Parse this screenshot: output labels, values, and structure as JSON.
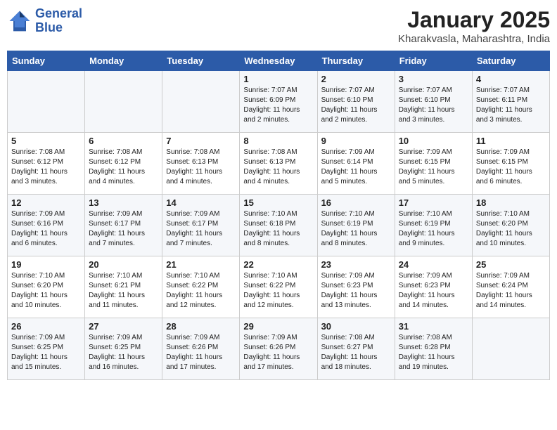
{
  "header": {
    "logo_line1": "General",
    "logo_line2": "Blue",
    "title": "January 2025",
    "subtitle": "Kharakvasla, Maharashtra, India"
  },
  "columns": [
    "Sunday",
    "Monday",
    "Tuesday",
    "Wednesday",
    "Thursday",
    "Friday",
    "Saturday"
  ],
  "weeks": [
    [
      {
        "day": "",
        "lines": []
      },
      {
        "day": "",
        "lines": []
      },
      {
        "day": "",
        "lines": []
      },
      {
        "day": "1",
        "lines": [
          "Sunrise: 7:07 AM",
          "Sunset: 6:09 PM",
          "Daylight: 11 hours",
          "and 2 minutes."
        ]
      },
      {
        "day": "2",
        "lines": [
          "Sunrise: 7:07 AM",
          "Sunset: 6:10 PM",
          "Daylight: 11 hours",
          "and 2 minutes."
        ]
      },
      {
        "day": "3",
        "lines": [
          "Sunrise: 7:07 AM",
          "Sunset: 6:10 PM",
          "Daylight: 11 hours",
          "and 3 minutes."
        ]
      },
      {
        "day": "4",
        "lines": [
          "Sunrise: 7:07 AM",
          "Sunset: 6:11 PM",
          "Daylight: 11 hours",
          "and 3 minutes."
        ]
      }
    ],
    [
      {
        "day": "5",
        "lines": [
          "Sunrise: 7:08 AM",
          "Sunset: 6:12 PM",
          "Daylight: 11 hours",
          "and 3 minutes."
        ]
      },
      {
        "day": "6",
        "lines": [
          "Sunrise: 7:08 AM",
          "Sunset: 6:12 PM",
          "Daylight: 11 hours",
          "and 4 minutes."
        ]
      },
      {
        "day": "7",
        "lines": [
          "Sunrise: 7:08 AM",
          "Sunset: 6:13 PM",
          "Daylight: 11 hours",
          "and 4 minutes."
        ]
      },
      {
        "day": "8",
        "lines": [
          "Sunrise: 7:08 AM",
          "Sunset: 6:13 PM",
          "Daylight: 11 hours",
          "and 4 minutes."
        ]
      },
      {
        "day": "9",
        "lines": [
          "Sunrise: 7:09 AM",
          "Sunset: 6:14 PM",
          "Daylight: 11 hours",
          "and 5 minutes."
        ]
      },
      {
        "day": "10",
        "lines": [
          "Sunrise: 7:09 AM",
          "Sunset: 6:15 PM",
          "Daylight: 11 hours",
          "and 5 minutes."
        ]
      },
      {
        "day": "11",
        "lines": [
          "Sunrise: 7:09 AM",
          "Sunset: 6:15 PM",
          "Daylight: 11 hours",
          "and 6 minutes."
        ]
      }
    ],
    [
      {
        "day": "12",
        "lines": [
          "Sunrise: 7:09 AM",
          "Sunset: 6:16 PM",
          "Daylight: 11 hours",
          "and 6 minutes."
        ]
      },
      {
        "day": "13",
        "lines": [
          "Sunrise: 7:09 AM",
          "Sunset: 6:17 PM",
          "Daylight: 11 hours",
          "and 7 minutes."
        ]
      },
      {
        "day": "14",
        "lines": [
          "Sunrise: 7:09 AM",
          "Sunset: 6:17 PM",
          "Daylight: 11 hours",
          "and 7 minutes."
        ]
      },
      {
        "day": "15",
        "lines": [
          "Sunrise: 7:10 AM",
          "Sunset: 6:18 PM",
          "Daylight: 11 hours",
          "and 8 minutes."
        ]
      },
      {
        "day": "16",
        "lines": [
          "Sunrise: 7:10 AM",
          "Sunset: 6:19 PM",
          "Daylight: 11 hours",
          "and 8 minutes."
        ]
      },
      {
        "day": "17",
        "lines": [
          "Sunrise: 7:10 AM",
          "Sunset: 6:19 PM",
          "Daylight: 11 hours",
          "and 9 minutes."
        ]
      },
      {
        "day": "18",
        "lines": [
          "Sunrise: 7:10 AM",
          "Sunset: 6:20 PM",
          "Daylight: 11 hours",
          "and 10 minutes."
        ]
      }
    ],
    [
      {
        "day": "19",
        "lines": [
          "Sunrise: 7:10 AM",
          "Sunset: 6:20 PM",
          "Daylight: 11 hours",
          "and 10 minutes."
        ]
      },
      {
        "day": "20",
        "lines": [
          "Sunrise: 7:10 AM",
          "Sunset: 6:21 PM",
          "Daylight: 11 hours",
          "and 11 minutes."
        ]
      },
      {
        "day": "21",
        "lines": [
          "Sunrise: 7:10 AM",
          "Sunset: 6:22 PM",
          "Daylight: 11 hours",
          "and 12 minutes."
        ]
      },
      {
        "day": "22",
        "lines": [
          "Sunrise: 7:10 AM",
          "Sunset: 6:22 PM",
          "Daylight: 11 hours",
          "and 12 minutes."
        ]
      },
      {
        "day": "23",
        "lines": [
          "Sunrise: 7:09 AM",
          "Sunset: 6:23 PM",
          "Daylight: 11 hours",
          "and 13 minutes."
        ]
      },
      {
        "day": "24",
        "lines": [
          "Sunrise: 7:09 AM",
          "Sunset: 6:23 PM",
          "Daylight: 11 hours",
          "and 14 minutes."
        ]
      },
      {
        "day": "25",
        "lines": [
          "Sunrise: 7:09 AM",
          "Sunset: 6:24 PM",
          "Daylight: 11 hours",
          "and 14 minutes."
        ]
      }
    ],
    [
      {
        "day": "26",
        "lines": [
          "Sunrise: 7:09 AM",
          "Sunset: 6:25 PM",
          "Daylight: 11 hours",
          "and 15 minutes."
        ]
      },
      {
        "day": "27",
        "lines": [
          "Sunrise: 7:09 AM",
          "Sunset: 6:25 PM",
          "Daylight: 11 hours",
          "and 16 minutes."
        ]
      },
      {
        "day": "28",
        "lines": [
          "Sunrise: 7:09 AM",
          "Sunset: 6:26 PM",
          "Daylight: 11 hours",
          "and 17 minutes."
        ]
      },
      {
        "day": "29",
        "lines": [
          "Sunrise: 7:09 AM",
          "Sunset: 6:26 PM",
          "Daylight: 11 hours",
          "and 17 minutes."
        ]
      },
      {
        "day": "30",
        "lines": [
          "Sunrise: 7:08 AM",
          "Sunset: 6:27 PM",
          "Daylight: 11 hours",
          "and 18 minutes."
        ]
      },
      {
        "day": "31",
        "lines": [
          "Sunrise: 7:08 AM",
          "Sunset: 6:28 PM",
          "Daylight: 11 hours",
          "and 19 minutes."
        ]
      },
      {
        "day": "",
        "lines": []
      }
    ]
  ]
}
